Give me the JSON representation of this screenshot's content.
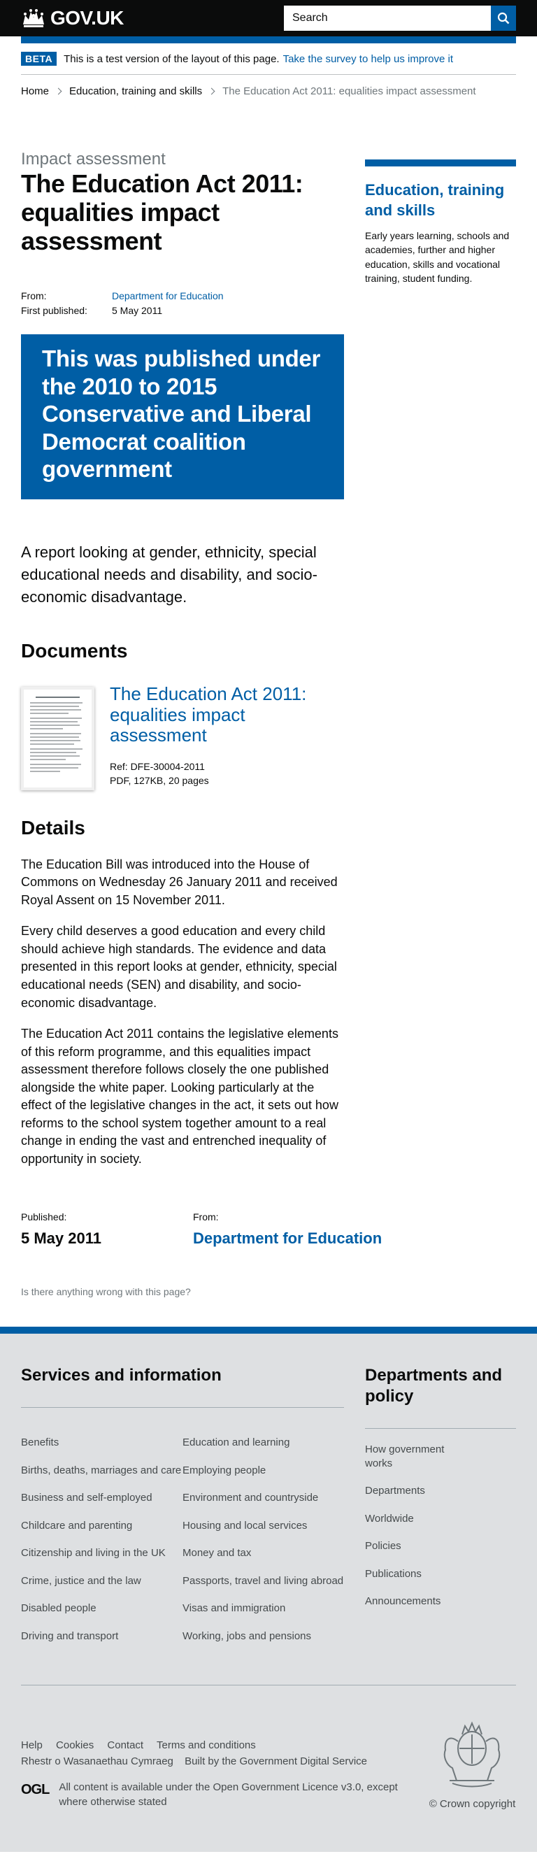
{
  "header": {
    "logo_text": "GOV.UK",
    "search_placeholder": "Search"
  },
  "beta": {
    "tag": "BETA",
    "text": "This is a test version of the layout of this page.",
    "link": "Take the survey to help us improve it"
  },
  "breadcrumb": {
    "items": [
      "Home",
      "Education, training and skills"
    ],
    "current": "The Education Act 2011: equalities impact assessment"
  },
  "page": {
    "caption": "Impact assessment",
    "title": "The Education Act 2011: equalities impact assessment",
    "meta": {
      "from_label": "From:",
      "from_value": "Department for Education",
      "published_label": "First published:",
      "published_value": "5 May 2011"
    },
    "history_banner": "This was published under the 2010 to 2015 Conservative and Liberal Democrat coalition government",
    "summary": "A report looking at gender, ethnicity, special educational needs and disability, and socio-economic disadvantage.",
    "documents_heading": "Documents",
    "attachment": {
      "title": "The Education Act 2011: equalities impact assessment",
      "ref": "Ref: DFE-30004-2011",
      "info": "PDF, 127KB, 20 pages"
    },
    "details_heading": "Details",
    "details": [
      "The Education Bill was introduced into the House of Commons on Wednesday 26 January 2011 and received Royal Assent on 15 November 2011.",
      "Every child deserves a good education and every child should achieve high standards. The evidence and data presented in this report looks at gender, ethnicity, special educational needs (SEN) and disability, and socio-economic disadvantage.",
      "The Education Act 2011 contains the legislative elements of this reform programme, and this equalities impact assessment therefore follows closely the one published alongside the white paper. Looking particularly at the effect of the legislative changes in the act, it sets out how reforms to the school system together amount to a real change in ending the vast and entrenched inequality of opportunity in society."
    ],
    "footer_meta": {
      "published_label": "Published:",
      "published_value": "5 May 2011",
      "from_label": "From:",
      "from_value": "Department for Education"
    },
    "report_link": "Is there anything wrong with this page?"
  },
  "sidebar": {
    "title": "Education, training and skills",
    "description": "Early years learning, schools and academies, further and higher education, skills and vocational training, student funding."
  },
  "footer": {
    "services_heading": "Services and information",
    "services_col1": [
      "Benefits",
      "Births, deaths, marriages and care",
      "Business and self-employed",
      "Childcare and parenting",
      "Citizenship and living in the UK",
      "Crime, justice and the law",
      "Disabled people",
      "Driving and transport"
    ],
    "services_col2": [
      "Education and learning",
      "Employing people",
      "Environment and countryside",
      "Housing and local services",
      "Money and tax",
      "Passports, travel and living abroad",
      "Visas and immigration",
      "Working, jobs and pensions"
    ],
    "departments_heading": "Departments and policy",
    "departments": [
      "How government works",
      "Departments",
      "Worldwide",
      "Policies",
      "Publications",
      "Announcements"
    ],
    "meta_links": [
      "Help",
      "Cookies",
      "Contact",
      "Terms and conditions"
    ],
    "welsh_link": "Rhestr o Wasanaethau Cymraeg",
    "built_by_text": "Built by the",
    "built_by_link": "Government Digital Service",
    "ogl_logo": "OGL",
    "licence_prefix": "All content is available under the",
    "licence_link": "Open Government Licence v3.0",
    "licence_suffix": ", except where otherwise stated",
    "copyright": "© Crown copyright"
  }
}
